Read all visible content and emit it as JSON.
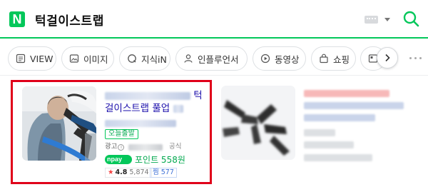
{
  "header": {
    "logo_letter": "N",
    "query": "턱걸이스트랩",
    "icons": {
      "keyboard": "keyboard-icon",
      "caret": "caret-down-icon",
      "search": "search-icon"
    },
    "brand_color": "#03c75a"
  },
  "tabs": [
    {
      "label": "VIEW",
      "icon": "view-icon"
    },
    {
      "label": "이미지",
      "icon": "image-icon"
    },
    {
      "label": "지식iN",
      "icon": "kin-icon"
    },
    {
      "label": "인플루언서",
      "icon": "influencer-icon"
    },
    {
      "label": "동영상",
      "icon": "video-icon"
    },
    {
      "label": "쇼핑",
      "icon": "shopping-bag-icon"
    }
  ],
  "ad": {
    "title_tail_1": "턱",
    "title_line_2": "걸이스트랩 풀업",
    "badge": "오늘출발",
    "ad_label": "광고",
    "official": "공식",
    "npay": "npay",
    "point": "포인트 558원",
    "rating": "4.8",
    "review_count": "5,874",
    "zzim": "찜 577",
    "highlight_color": "#e0001a"
  }
}
